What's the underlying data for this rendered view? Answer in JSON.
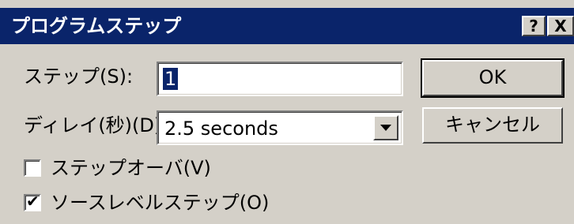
{
  "window": {
    "title": "プログラムステップ",
    "help_button": "?",
    "close_button": "X"
  },
  "step": {
    "label": "ステップ(S):",
    "value": "1"
  },
  "delay": {
    "label": "ディレイ(秒)(D):",
    "selected": "2.5 seconds"
  },
  "buttons": {
    "ok": "OK",
    "cancel": "キャンセル"
  },
  "checkboxes": [
    {
      "label": "ステップオーバ(V)",
      "checked": false
    },
    {
      "label": "ソースレベルステップ(O)",
      "checked": true
    }
  ],
  "icons": {
    "help": "question-mark",
    "close": "x",
    "dropdown": "triangle-down",
    "checkmark": "check"
  },
  "colors": {
    "titlebar": "#0a246a",
    "face": "#d4d0c8",
    "selection": "#0a246a"
  }
}
